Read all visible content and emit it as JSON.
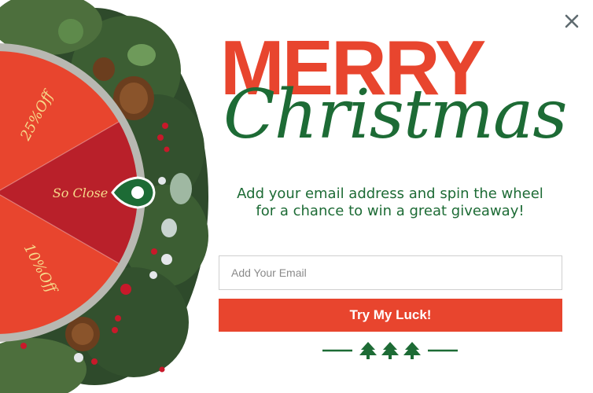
{
  "headline": {
    "line1": "MERRY",
    "line2": "Christmas"
  },
  "description": "Add your email address and spin the wheel for a chance to win a great giveaway!",
  "email_field": {
    "placeholder": "Add Your Email",
    "value": ""
  },
  "cta": {
    "label": "Try My Luck!"
  },
  "wheel": {
    "segments": [
      "25%Off",
      "So Close",
      "10%Off"
    ],
    "colors": {
      "light": "#e8452e",
      "dark": "#b9202a",
      "pointer": "#1d6b35"
    }
  },
  "colors": {
    "accent": "#e8452e",
    "green": "#1d6b35"
  },
  "icons": {
    "close": "close-icon",
    "divider": "tree-icon"
  }
}
